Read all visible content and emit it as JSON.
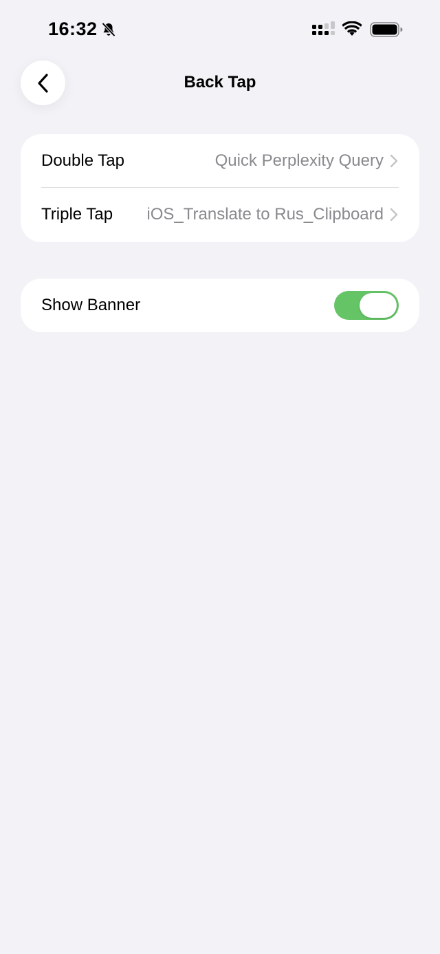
{
  "status_bar": {
    "time": "16:32",
    "icons": [
      "bell-slash-icon",
      "cellular-signal-icon",
      "wifi-icon",
      "battery-icon"
    ]
  },
  "nav": {
    "back_icon": "chevron-left-icon",
    "title": "Back Tap"
  },
  "taps": [
    {
      "label": "Double Tap",
      "value": "Quick Perplexity Query"
    },
    {
      "label": "Triple Tap",
      "value": "iOS_Translate to Rus_Clipboard"
    }
  ],
  "banner": {
    "label": "Show Banner",
    "enabled": true
  },
  "colors": {
    "background": "#f2f2f7",
    "toggle_on": "#65c466",
    "secondary_text": "#8a8a8e"
  }
}
